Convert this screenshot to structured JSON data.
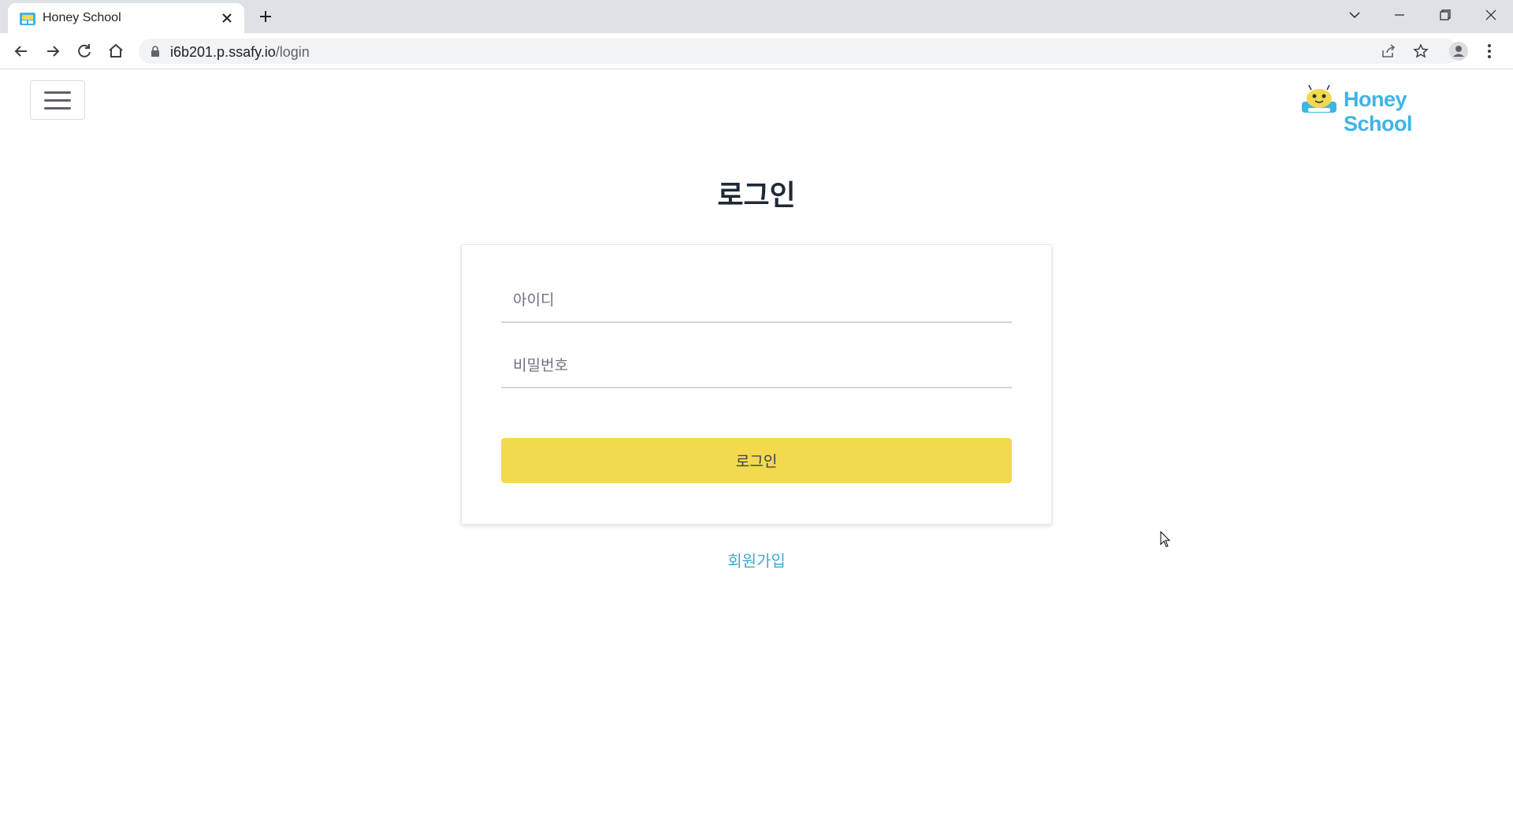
{
  "browser": {
    "tab_title": "Honey School",
    "url_host": "i6b201.p.ssafy.io",
    "url_path": "/login"
  },
  "header": {
    "brand_name": "Honey School"
  },
  "login": {
    "title": "로그인",
    "username_placeholder": "아이디",
    "password_placeholder": "비밀번호",
    "submit_label": "로그인",
    "signup_link": "회원가입"
  },
  "colors": {
    "brand_blue": "#3fb4e5",
    "button_yellow": "#f2d94e",
    "link_blue": "#3fa9d9"
  },
  "icons": [
    "favicon-icon",
    "close-icon",
    "plus-icon",
    "chevron-down-icon",
    "minimize-icon",
    "restore-icon",
    "window-close-icon",
    "back-icon",
    "forward-icon",
    "reload-icon",
    "home-icon",
    "lock-icon",
    "share-icon",
    "star-icon",
    "profile-icon",
    "more-vert-icon",
    "hamburger-icon",
    "logo-icon",
    "cursor-icon"
  ]
}
